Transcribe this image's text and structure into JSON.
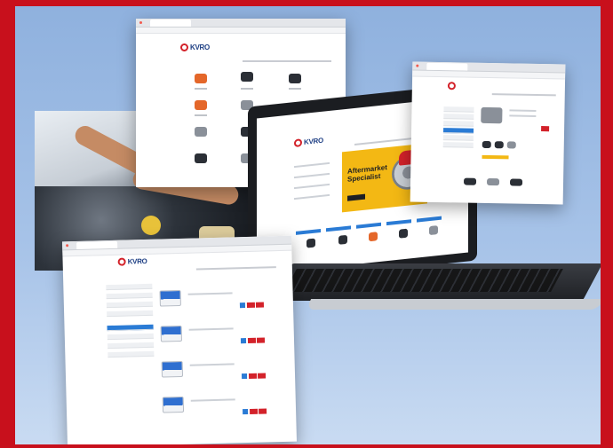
{
  "image": {
    "description_visible_text": [],
    "brand_logo": "KVRO",
    "banner": {
      "kicker": "",
      "headline_line1": "Aftermarket",
      "headline_line2": "Specialist"
    }
  },
  "colors": {
    "frame": "#c8101c",
    "background_gradient_top": "#8fb1de",
    "accent_blue": "#2a7bd5",
    "accent_red": "#d3222a",
    "banner_yellow": "#f3b814"
  }
}
